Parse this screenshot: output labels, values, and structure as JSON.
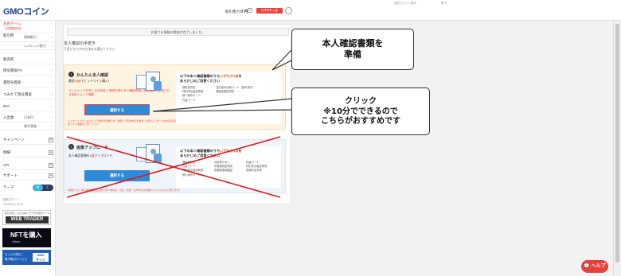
{
  "header": {
    "logo": "GMOコイン",
    "links": [
      "別窓でサイト表示",
      "終了"
    ],
    "balance_label": "取引余力",
    "balance_value": "0 円",
    "deposit_button": "日本円を入金",
    "refresh_icon": "refresh-icon",
    "user_icon": "user-icon"
  },
  "sidebar": {
    "home": "会員ホーム",
    "home_sub": "（口座開設申請）",
    "items": [
      {
        "label": "取引所",
        "sub": "現物取引"
      },
      {
        "label": "",
        "sub": "レバレッジ取引"
      },
      {
        "label": "販売所"
      },
      {
        "label": "暗号資産FX"
      },
      {
        "label": "貸暗号資産"
      },
      {
        "label": "つみたて暗号資産"
      },
      {
        "label": "IEO"
      },
      {
        "label": "入出金",
        "sub": "日本円"
      },
      {
        "label": "",
        "sub": "暗号資産"
      },
      {
        "label": "キャンペーン"
      },
      {
        "label": "明細"
      },
      {
        "label": "API"
      },
      {
        "label": "サポート"
      },
      {
        "label": "テーマ"
      }
    ],
    "login_label": "最終ログイン",
    "login_time": "2024/07/11 12:34",
    "banner_webtrader_caption": "取引が楽しくなるWebブラウザの取引ツール",
    "banner_webtrader": "WEB TRADER",
    "banner_nft": "NFTを購入",
    "banner_nft_sub": "Adam",
    "banner_gmo_line1": "もっとお得に！",
    "banner_gmo_line2": "電子取引サービス",
    "banner_gmo_logo_line1": "GMO",
    "banner_gmo_logo_line2": "サイン"
  },
  "main": {
    "notice": "お客さま情報の登録が完了しました。",
    "title": "本人確認の手続き",
    "desc": "下記どちらかの方法をお選びください",
    "option1": {
      "num": "1",
      "title": "かんたん本人確認",
      "sub_pre": "最短",
      "sub_hl": "10分",
      "sub_post": "でビットコイン購入！",
      "note": "オンラインでお申し込み完結 ご登録の際に本人確認書類と顔を撮影し登録される技術によって撮影",
      "button": "選択する",
      "fine": "※スマートフォンのカメラで撮影が必要です。撮影に不安がある場合は 上記のメッセージをお読み頂き、審査完了まで画面はご覧ください",
      "req_title_1": "以下の本人確認書類のうち",
      "req_title_dot": "いずれか1点",
      "req_title_2": "を",
      "req_title_3": "あらかじめご用意ください",
      "req_list": [
        "運転免許証",
        "特別永住者証明書",
        "個人番号カード",
        "在留カード"
      ],
      "req_list2": [
        "住民基本台帳カード（顔写真付）",
        "運転経歴証明書"
      ]
    },
    "option2": {
      "num": "2",
      "title": "画像アップロード",
      "sub_pre": "本人確認書類を",
      "sub_hl": "2点",
      "sub_post": "アップロード",
      "button": "選択する",
      "req_title_1": "以下の本人確認書類のうち",
      "req_title_dot": "いずれか1点",
      "req_title_2": "を",
      "req_title_3": "あらかじめご用意ください",
      "req_col1": [
        "運転免許証",
        "在留カード",
        "特別永住者証明書",
        "個人番号カード"
      ],
      "req_col2": [
        "住民票の写し",
        "印鑑登録証明書",
        "各種健康保険証"
      ],
      "req_col3": [
        "在留カード",
        "特別永住者証明書",
        "各種年金手帳"
      ],
      "bottom_note": "※郵送でのご本人確認書類をお送り頂く場合は、氏名・住所・生年月日が記載されているものに限ります。"
    }
  },
  "callouts": {
    "c1_line1": "本人確認書類を",
    "c1_line2": "準備",
    "c2_line1": "クリック",
    "c2_line2": "※10分でできるので",
    "c2_line3": "こちらがおすすめです"
  },
  "help": "ヘルプ"
}
